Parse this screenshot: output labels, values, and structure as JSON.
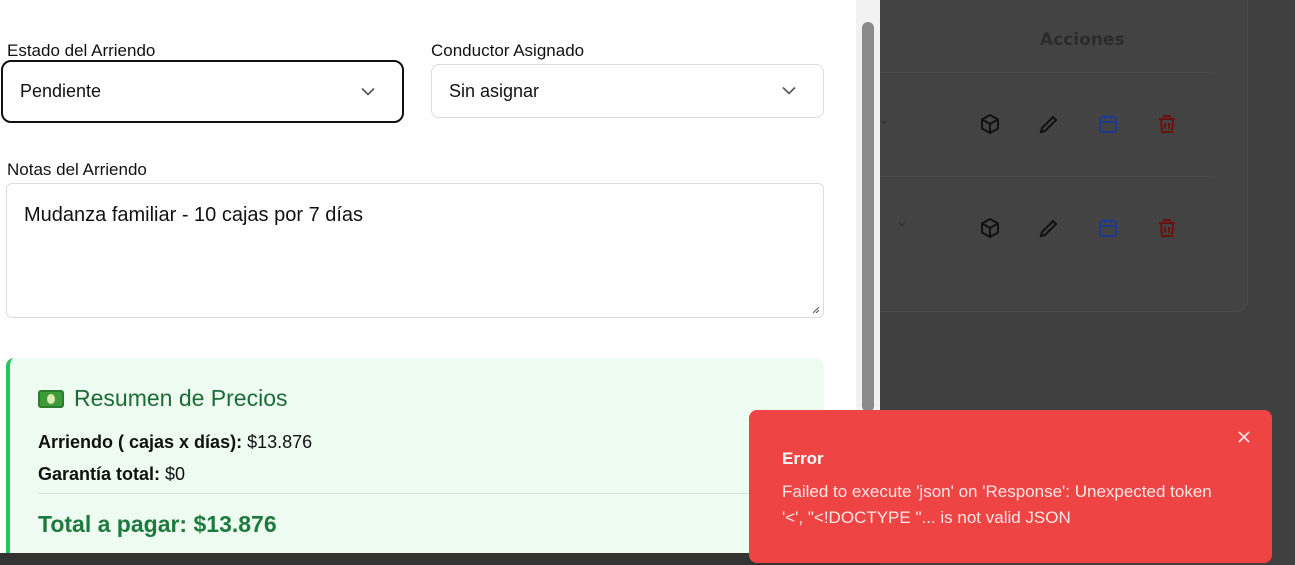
{
  "form": {
    "status_label": "Estado del Arriendo",
    "status_value": "Pendiente",
    "driver_label": "Conductor Asignado",
    "driver_value": "Sin asignar",
    "notes_label": "Notas del Arriendo",
    "notes_value": "Mudanza familiar - 10 cajas por 7 días"
  },
  "summary": {
    "title": "Resumen de Precios",
    "rental_label": "Arriendo ( cajas x días):",
    "rental_value": "$13.876",
    "deposit_label": "Garantía total:",
    "deposit_value": "$0",
    "total_text": "Total a pagar: $13.876",
    "accent_color": "#22c55e"
  },
  "background": {
    "actions_header": "Acciones",
    "row_icons": [
      "box-icon",
      "pencil-icon",
      "calendar-icon",
      "trash-icon"
    ]
  },
  "toast": {
    "title": "Error",
    "message": "Failed to execute 'json' on 'Response': Unexpected token '<', \"<!DOCTYPE \"... is not valid JSON",
    "color": "#ef4444"
  }
}
